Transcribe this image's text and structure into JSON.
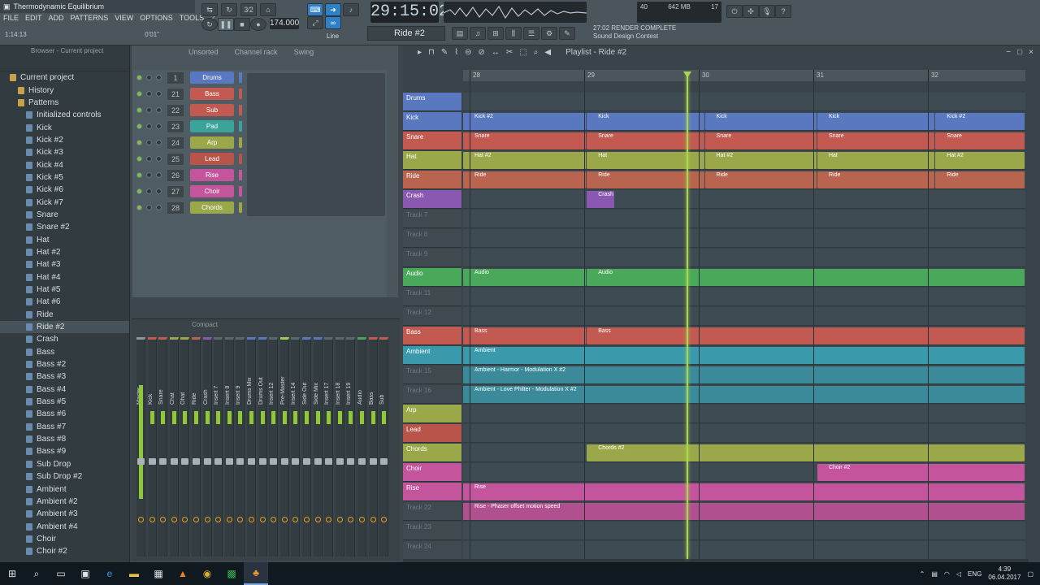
{
  "app": {
    "title": "Thermodynamic Equilibrium"
  },
  "menu": [
    "FILE",
    "EDIT",
    "ADD",
    "PATTERNS",
    "VIEW",
    "OPTIONS",
    "TOOLS",
    "?"
  ],
  "hint": {
    "left": "1:14:13",
    "right": "0'01\""
  },
  "transport": {
    "time": "29:15:02",
    "tempo": "174.000",
    "snap": "Line",
    "pattern": "Ride #2"
  },
  "memory": {
    "a": "40",
    "b": "642 MB",
    "c": "17"
  },
  "news": {
    "line1": "27:02  RENDER COMPLETE",
    "line2": "Sound Design Contest"
  },
  "browser": {
    "header": "Browser - Current project",
    "items": [
      {
        "label": "Current project",
        "type": "folder"
      },
      {
        "label": "History",
        "type": "folder"
      },
      {
        "label": "Patterns",
        "type": "folder"
      },
      {
        "label": "Initialized controls",
        "type": "item"
      },
      {
        "label": "Kick",
        "type": "item"
      },
      {
        "label": "Kick #2",
        "type": "item"
      },
      {
        "label": "Kick #3",
        "type": "item"
      },
      {
        "label": "Kick #4",
        "type": "item"
      },
      {
        "label": "Kick #5",
        "type": "item"
      },
      {
        "label": "Kick #6",
        "type": "item"
      },
      {
        "label": "Kick #7",
        "type": "item"
      },
      {
        "label": "Snare",
        "type": "item"
      },
      {
        "label": "Snare #2",
        "type": "item"
      },
      {
        "label": "Hat",
        "type": "item"
      },
      {
        "label": "Hat #2",
        "type": "item"
      },
      {
        "label": "Hat #3",
        "type": "item"
      },
      {
        "label": "Hat #4",
        "type": "item"
      },
      {
        "label": "Hat #5",
        "type": "item"
      },
      {
        "label": "Hat #6",
        "type": "item"
      },
      {
        "label": "Ride",
        "type": "item"
      },
      {
        "label": "Ride #2",
        "type": "item",
        "selected": true
      },
      {
        "label": "Crash",
        "type": "item"
      },
      {
        "label": "Bass",
        "type": "item"
      },
      {
        "label": "Bass #2",
        "type": "item"
      },
      {
        "label": "Bass #3",
        "type": "item"
      },
      {
        "label": "Bass #4",
        "type": "item"
      },
      {
        "label": "Bass #5",
        "type": "item"
      },
      {
        "label": "Bass #6",
        "type": "item"
      },
      {
        "label": "Bass #7",
        "type": "item"
      },
      {
        "label": "Bass #8",
        "type": "item"
      },
      {
        "label": "Bass #9",
        "type": "item"
      },
      {
        "label": "Sub Drop",
        "type": "item"
      },
      {
        "label": "Sub Drop #2",
        "type": "item"
      },
      {
        "label": "Ambient",
        "type": "item"
      },
      {
        "label": "Ambient #2",
        "type": "item"
      },
      {
        "label": "Ambient #3",
        "type": "item"
      },
      {
        "label": "Ambient #4",
        "type": "item"
      },
      {
        "label": "Choir",
        "type": "item"
      },
      {
        "label": "Choir #2",
        "type": "item"
      }
    ]
  },
  "rack": {
    "filter": "Unsorted",
    "title": "Channel rack",
    "swing": "Swing",
    "channels": [
      {
        "num": "1",
        "name": "Drums",
        "color": "#5a78c0"
      },
      {
        "num": "21",
        "name": "Bass",
        "color": "#c25a52"
      },
      {
        "num": "22",
        "name": "Sub",
        "color": "#c25a52"
      },
      {
        "num": "23",
        "name": "Pad",
        "color": "#3aa39a"
      },
      {
        "num": "24",
        "name": "Arp",
        "color": "#9aa84a"
      },
      {
        "num": "25",
        "name": "Lead",
        "color": "#b8544a"
      },
      {
        "num": "26",
        "name": "Rise",
        "color": "#c4549c"
      },
      {
        "num": "27",
        "name": "Choir",
        "color": "#c4549c"
      },
      {
        "num": "28",
        "name": "Chords",
        "color": "#9aa84a"
      }
    ]
  },
  "mixer": {
    "mode": "Compact",
    "strips": [
      "Master",
      "Kick",
      "Snare",
      "Chat",
      "Ohat",
      "Ride",
      "Crash",
      "Insert 7",
      "Insert 8",
      "Insert 9",
      "Drums Mix",
      "Drums Out",
      "Insert 12",
      "Pre-Master",
      "Insert 14",
      "Side Out",
      "Side Mix",
      "Insert 17",
      "Insert 18",
      "Insert 19",
      "Audio",
      "Bass",
      "Sub"
    ]
  },
  "playlist": {
    "title": "Playlist - Ride #2",
    "bars": [
      "28",
      "29",
      "30",
      "31",
      "32"
    ],
    "tracks": [
      {
        "name": "Drums",
        "color": "#5a78c0",
        "clips": []
      },
      {
        "name": "Kick",
        "color": "#5a78c0",
        "clips": [
          {
            "label": "Kick #2",
            "from": 0,
            "to": 0.22
          },
          {
            "label": "Kick",
            "from": 0.22,
            "to": 0.43
          },
          {
            "label": "Kick",
            "from": 0.43,
            "to": 0.63
          },
          {
            "label": "Kick",
            "from": 0.63,
            "to": 0.84
          },
          {
            "label": "Kick #2",
            "from": 0.84,
            "to": 1
          }
        ]
      },
      {
        "name": "Snare",
        "color": "#c25a52",
        "clips": [
          {
            "label": "Snare",
            "from": 0,
            "to": 0.22
          },
          {
            "label": "Snare",
            "from": 0.22,
            "to": 0.43
          },
          {
            "label": "Snare",
            "from": 0.43,
            "to": 0.63
          },
          {
            "label": "Snare",
            "from": 0.63,
            "to": 0.84
          },
          {
            "label": "Snare",
            "from": 0.84,
            "to": 1
          }
        ]
      },
      {
        "name": "Hat",
        "color": "#9aa84a",
        "clips": [
          {
            "label": "Hat #2",
            "from": 0,
            "to": 0.22
          },
          {
            "label": "Hat",
            "from": 0.22,
            "to": 0.43
          },
          {
            "label": "Hat #2",
            "from": 0.43,
            "to": 0.63
          },
          {
            "label": "Hat",
            "from": 0.63,
            "to": 0.84
          },
          {
            "label": "Hat #2",
            "from": 0.84,
            "to": 1
          }
        ]
      },
      {
        "name": "Ride",
        "color": "#b8644e",
        "clips": [
          {
            "label": "Ride",
            "from": 0,
            "to": 0.22
          },
          {
            "label": "Ride",
            "from": 0.22,
            "to": 0.43
          },
          {
            "label": "Ride",
            "from": 0.43,
            "to": 0.63
          },
          {
            "label": "Ride",
            "from": 0.63,
            "to": 0.84
          },
          {
            "label": "Ride",
            "from": 0.84,
            "to": 1
          }
        ]
      },
      {
        "name": "Crash",
        "color": "#8a58b0",
        "clips": [
          {
            "label": "Crash",
            "from": 0.22,
            "to": 0.27
          }
        ]
      },
      {
        "name": "Track 7",
        "color": "",
        "clips": []
      },
      {
        "name": "Track 8",
        "color": "",
        "clips": []
      },
      {
        "name": "Track 9",
        "color": "",
        "clips": []
      },
      {
        "name": "Audio",
        "color": "#4aa85a",
        "clips": [
          {
            "label": "Audio",
            "from": 0,
            "to": 0.22
          },
          {
            "label": "Audio",
            "from": 0.22,
            "to": 1
          }
        ]
      },
      {
        "name": "Track 11",
        "color": "",
        "clips": []
      },
      {
        "name": "Track 12",
        "color": "",
        "clips": []
      },
      {
        "name": "Bass",
        "color": "#c25a52",
        "clips": [
          {
            "label": "Bass",
            "from": 0,
            "to": 0.22
          },
          {
            "label": "Bass",
            "from": 0.22,
            "to": 1
          }
        ]
      },
      {
        "name": "Ambient",
        "color": "#3a9aac",
        "clips": [
          {
            "label": "Ambient",
            "from": 0,
            "to": 1
          }
        ]
      },
      {
        "name": "Track 15",
        "color": "",
        "clips": [
          {
            "label": "Ambient - Harmor - Modulation X #2",
            "from": 0,
            "to": 1,
            "color": "#3a8a9a"
          }
        ]
      },
      {
        "name": "Track 16",
        "color": "",
        "clips": [
          {
            "label": "Ambient - Love Philter - Modulation X #2",
            "from": 0,
            "to": 1,
            "color": "#3a8a9a"
          }
        ]
      },
      {
        "name": "Arp",
        "color": "#9aa84a",
        "clips": []
      },
      {
        "name": "Lead",
        "color": "#b8544a",
        "clips": []
      },
      {
        "name": "Chords",
        "color": "#9aa84a",
        "clips": [
          {
            "label": "Chords #2",
            "from": 0.22,
            "to": 1
          }
        ]
      },
      {
        "name": "Choir",
        "color": "#c4549c",
        "clips": [
          {
            "label": "Choir #2",
            "from": 0.63,
            "to": 1
          }
        ]
      },
      {
        "name": "Rise",
        "color": "#c4549c",
        "clips": [
          {
            "label": "Rise",
            "from": 0,
            "to": 1
          }
        ]
      },
      {
        "name": "Track 22",
        "color": "",
        "clips": [
          {
            "label": "Rise - Phaser offset motion speed",
            "from": 0,
            "to": 1,
            "color": "#b0508e"
          }
        ]
      },
      {
        "name": "Track 23",
        "color": "",
        "clips": []
      },
      {
        "name": "Track 24",
        "color": "",
        "clips": []
      }
    ]
  },
  "taskbar": {
    "lang": "ENG",
    "time": "4:39",
    "date": "06.04.2017"
  }
}
